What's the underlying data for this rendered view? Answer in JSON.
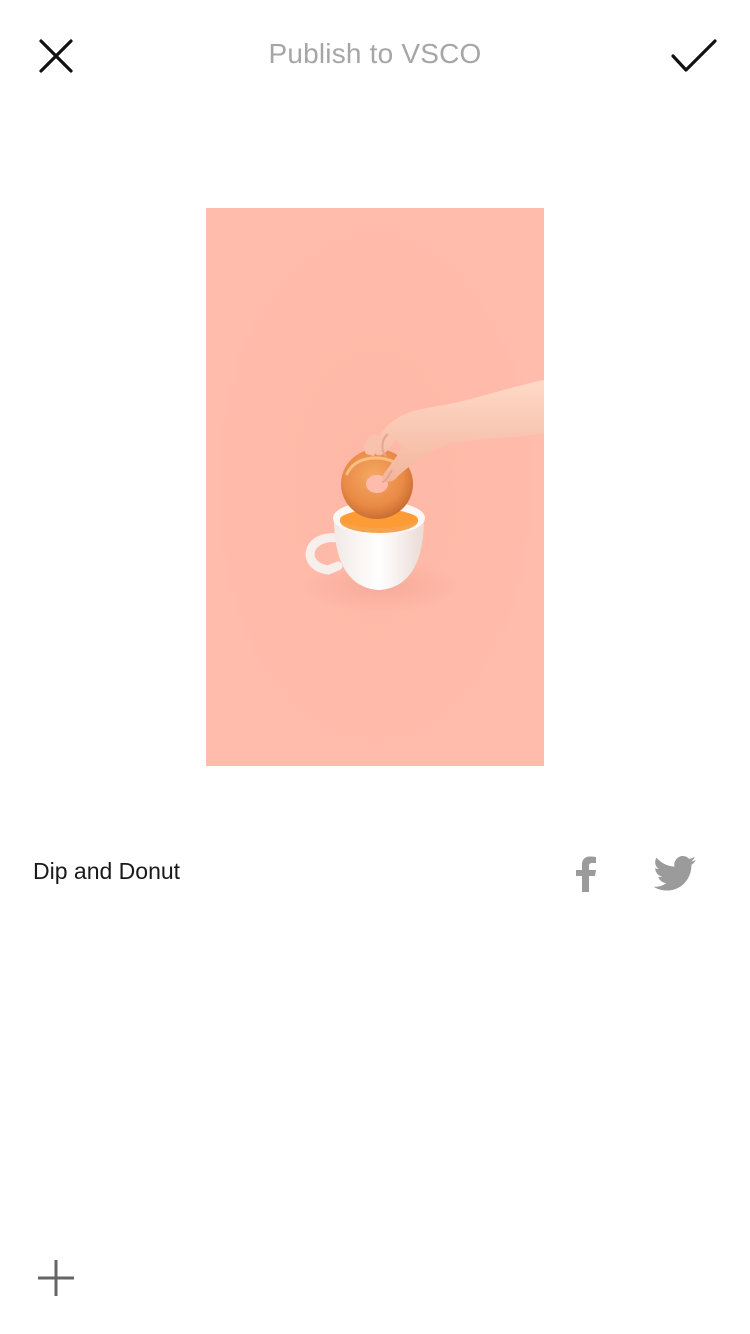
{
  "header": {
    "title": "Publish to VSCO",
    "close_icon": "close-icon",
    "confirm_icon": "checkmark-icon"
  },
  "photo": {
    "subject": "hand dipping donut into cup",
    "background_color": "#ffb9a8"
  },
  "caption": {
    "text": "Dip and Donut"
  },
  "share": {
    "facebook_icon": "facebook-icon",
    "twitter_icon": "twitter-icon",
    "icon_color": "#9b9b9b"
  },
  "footer": {
    "add_icon": "plus-icon"
  }
}
